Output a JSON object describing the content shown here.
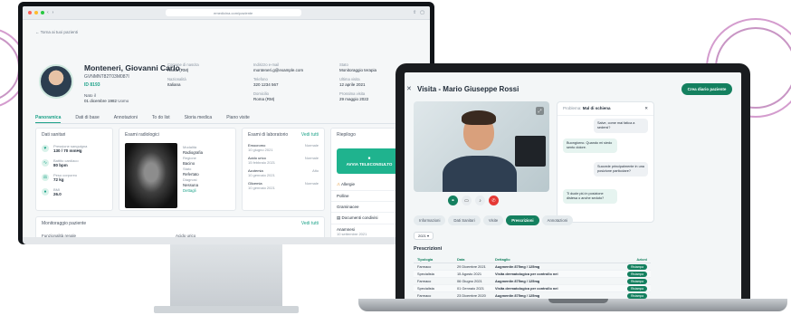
{
  "desktop": {
    "browser": {
      "url": "emedicina.com/paziente"
    },
    "back_link": "Torna ai tuoi pazienti",
    "patient": {
      "name": "Monteneri, Giovanni Carlo",
      "fiscal_code": "GVNMNT82T03M087I",
      "id": "ID 8193",
      "dob_label": "Nato il",
      "dob": "01 dicembre 1982",
      "sex": "Uomo",
      "fields": [
        {
          "label": "Comune di nascita",
          "value": "Roma (RM)"
        },
        {
          "label": "Nazionalità",
          "value": "Italiana"
        },
        {
          "label": "Indirizzo e-mail",
          "value": "monteneri.g@example.com"
        },
        {
          "label": "Telefono",
          "value": "320 1234 567"
        },
        {
          "label": "Domicilio",
          "value": "Roma (RM)"
        },
        {
          "label": "Stato",
          "value": "Monitoraggio terapia"
        },
        {
          "label": "Ultima visita",
          "value": "12 aprile 2021"
        },
        {
          "label": "Prossima visita",
          "value": "29 maggio 2022"
        }
      ]
    },
    "tabs": [
      "Panoramica",
      "Dati di base",
      "Annotazioni",
      "To do list",
      "Storia medica",
      "Piano visite"
    ],
    "vitals_card": {
      "title": "Dati sanitari",
      "items": [
        {
          "label": "Pressione sanguigna",
          "value": "130 / 70 mmHg"
        },
        {
          "label": "Battito cardiaco",
          "value": "80 bpm"
        },
        {
          "label": "Peso corporeo",
          "value": "72 kg"
        },
        {
          "label": "BMI",
          "value": "26.0"
        }
      ]
    },
    "xray_card": {
      "title": "Esami radiologici",
      "meta": [
        {
          "label": "Modalità",
          "value": "Radiografia"
        },
        {
          "label": "Regione",
          "value": "Bacino"
        },
        {
          "label": "Stato",
          "value": "Refertato"
        },
        {
          "label": "Diagnosi",
          "value": "Nessuna"
        }
      ],
      "link": "Dettagli"
    },
    "lab_card": {
      "title": "Esami di laboratorio",
      "link": "Vedi tutti",
      "rows": [
        {
          "name": "Emocromo",
          "date": "10 giugno 2021",
          "status": "Normale"
        },
        {
          "name": "Acido urico",
          "date": "15 febbraio 2021",
          "status": "Normale"
        },
        {
          "name": "Azotemia",
          "date": "10 gennaio 2021",
          "status": "Alto"
        },
        {
          "name": "Glicemia",
          "date": "10 gennaio 2021",
          "status": "Normale"
        }
      ]
    },
    "right_card": {
      "title": "Riepilogo",
      "tele_button": "AVVIA TELECONSULTO",
      "section_allergies": "Allergie",
      "items": [
        "Polline",
        "Graminacee"
      ],
      "documents": "Documenti condivisi",
      "doc_item": "Anamnesi",
      "doc_date": "10 settembre 2021"
    },
    "monitor_card": {
      "title": "Monitoraggio paziente",
      "link": "Vedi tutti",
      "cols": [
        "Funzionalità renale",
        "Acido urico"
      ]
    }
  },
  "laptop": {
    "title": "Visita - Mario Giuseppe Rossi",
    "diary_button": "Crea diario paziente",
    "chat": {
      "header_label": "Problema:",
      "header_value": "Mal di schiena",
      "messages": [
        {
          "dir": "out",
          "text": "Salve, come mai fatica a sedersi?"
        },
        {
          "dir": "in",
          "text": "Buongiorno. Quando mi siedo sento dolore."
        },
        {
          "dir": "out",
          "text": "Succede principalmente in una posizione particolare?"
        },
        {
          "dir": "in",
          "text": "Ti duole più in posizione distesa o anche seduto?"
        }
      ]
    },
    "tabs": [
      "Informazioni",
      "Dati Sanitari",
      "Visite",
      "Prescrizioni",
      "Annotazioni"
    ],
    "active_tab": "Prescrizioni",
    "year": "2021",
    "section_title": "Prescrizioni",
    "table": {
      "headers": [
        "Tipologia",
        "Data",
        "Dettaglio",
        "Azioni"
      ],
      "rows": [
        {
          "type": "Farmaco",
          "date": "29 Dicembre 2021",
          "detail": "Augmentin 875mg / 125mg",
          "action": "Ristampa"
        },
        {
          "type": "Specialista",
          "date": "15 Agosto 2021",
          "detail": "Visita dermatologica per controllo nei",
          "action": "Ristampa"
        },
        {
          "type": "Farmaco",
          "date": "06 Giugno 2021",
          "detail": "Augmentin 875mg / 125mg",
          "action": "Ristampa"
        },
        {
          "type": "Specialista",
          "date": "01 Gennaio 2021",
          "detail": "Visita dermatologica per controllo nei",
          "action": "Ristampa"
        },
        {
          "type": "Farmaco",
          "date": "23 Dicembre 2020",
          "detail": "Augmentin 875mg / 125mg",
          "action": "Ristampa"
        }
      ]
    }
  }
}
